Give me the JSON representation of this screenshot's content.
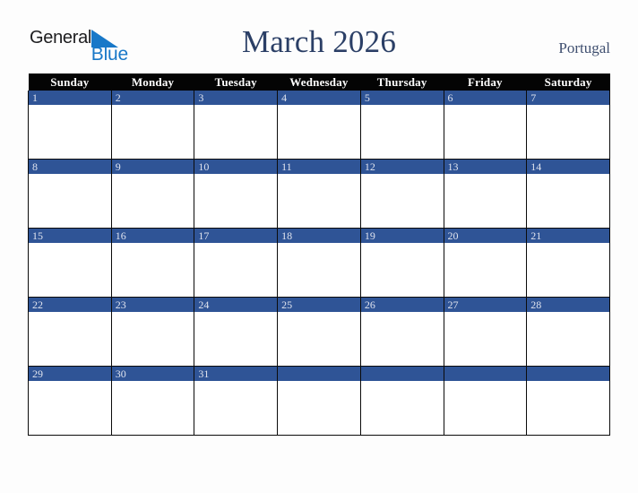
{
  "brand": {
    "name_part1": "General",
    "name_part2": "Blue",
    "triangle_color": "#1878c8",
    "part1_color": "#1d1d1f"
  },
  "header": {
    "title": "March 2026",
    "title_color": "#2b3f66",
    "country": "Portugal",
    "country_color": "#405070"
  },
  "calendar": {
    "accent_color": "#2f5496",
    "header_bg": "#040404",
    "header_text_color": "#ffffff",
    "date_text_color": "#dfe3ee",
    "weekday_headers": [
      "Sunday",
      "Monday",
      "Tuesday",
      "Wednesday",
      "Thursday",
      "Friday",
      "Saturday"
    ],
    "weeks": [
      [
        {
          "date": "1"
        },
        {
          "date": "2"
        },
        {
          "date": "3"
        },
        {
          "date": "4"
        },
        {
          "date": "5"
        },
        {
          "date": "6"
        },
        {
          "date": "7"
        }
      ],
      [
        {
          "date": "8"
        },
        {
          "date": "9"
        },
        {
          "date": "10"
        },
        {
          "date": "11"
        },
        {
          "date": "12"
        },
        {
          "date": "13"
        },
        {
          "date": "14"
        }
      ],
      [
        {
          "date": "15"
        },
        {
          "date": "16"
        },
        {
          "date": "17"
        },
        {
          "date": "18"
        },
        {
          "date": "19"
        },
        {
          "date": "20"
        },
        {
          "date": "21"
        }
      ],
      [
        {
          "date": "22"
        },
        {
          "date": "23"
        },
        {
          "date": "24"
        },
        {
          "date": "25"
        },
        {
          "date": "26"
        },
        {
          "date": "27"
        },
        {
          "date": "28"
        }
      ],
      [
        {
          "date": "29"
        },
        {
          "date": "30"
        },
        {
          "date": "31"
        },
        {
          "date": ""
        },
        {
          "date": ""
        },
        {
          "date": ""
        },
        {
          "date": ""
        }
      ]
    ]
  }
}
